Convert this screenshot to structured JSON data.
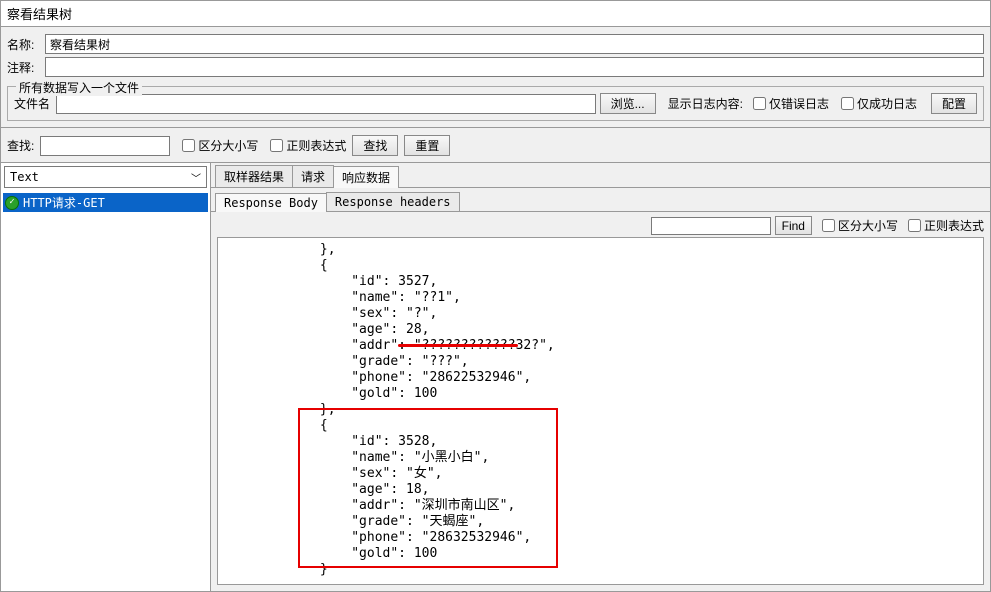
{
  "title": "察看结果树",
  "form": {
    "name_label": "名称:",
    "name_value": "察看结果树",
    "comment_label": "注释:",
    "comment_value": ""
  },
  "file_group": {
    "legend": "所有数据写入一个文件",
    "filename_label": "文件名",
    "filename_value": "",
    "browse_btn": "浏览...",
    "log_display_label": "显示日志内容:",
    "cb_error_only": "仅错误日志",
    "cb_success_only": "仅成功日志",
    "config_btn": "配置"
  },
  "search": {
    "label": "查找:",
    "value": "",
    "cb_case": "区分大小写",
    "cb_regex": "正则表达式",
    "find_btn": "查找",
    "reset_btn": "重置"
  },
  "left": {
    "combo_value": "Text",
    "tree_item": "HTTP请求-GET"
  },
  "tabs1": {
    "sampler": "取样器结果",
    "request": "请求",
    "response": "响应数据"
  },
  "tabs2": {
    "body": "Response Body",
    "headers": "Response headers"
  },
  "find_bar": {
    "find_btn": "Find",
    "cb_case": "区分大小写",
    "cb_regex": "正则表达式"
  },
  "response_text": "            },\n            {\n                \"id\": 3527,\n                \"name\": \"??1\",\n                \"sex\": \"?\",\n                \"age\": 28,\n                \"addr\": \"????????????32?\",\n                \"grade\": \"???\",\n                \"phone\": \"28622532946\",\n                \"gold\": 100\n            },\n            {\n                \"id\": 3528,\n                \"name\": \"小黑小白\",\n                \"sex\": \"女\",\n                \"age\": 18,\n                \"addr\": \"深圳市南山区\",\n                \"grade\": \"天蝎座\",\n                \"phone\": \"28632532946\",\n                \"gold\": 100\n            }"
}
